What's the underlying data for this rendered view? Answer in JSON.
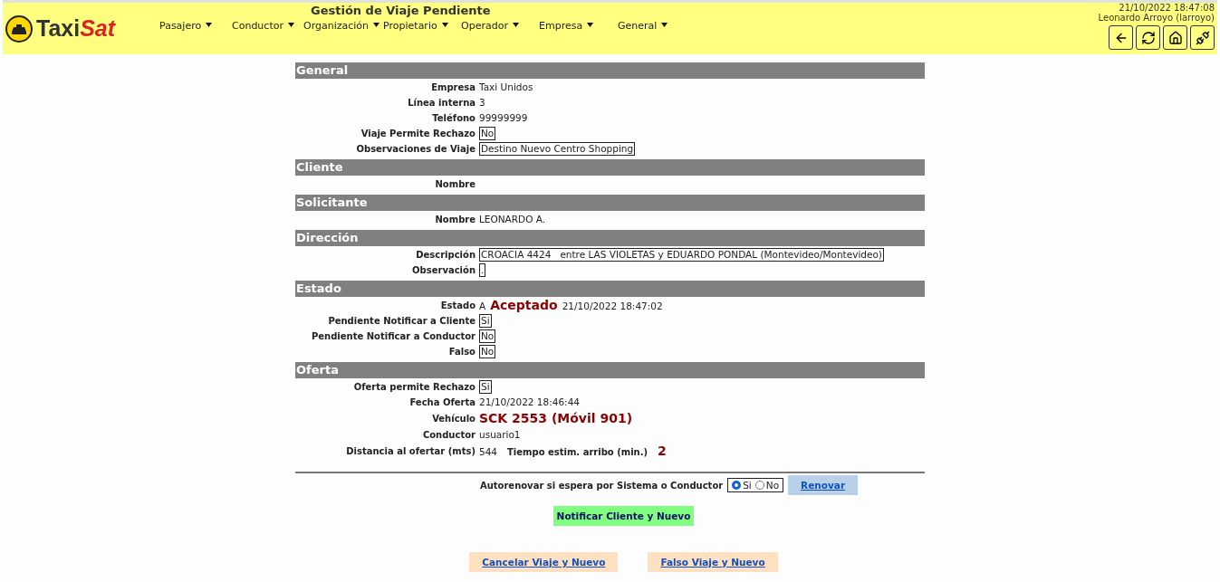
{
  "header": {
    "logo": [
      {
        "kind": "plain",
        "text": "Taxi"
      },
      {
        "kind": "accent",
        "text": "Sat"
      }
    ],
    "title": "Gestión de Viaje Pendiente",
    "datetime": "21/10/2022 18:47:08",
    "user": "Leonardo Arroyo (larroyo)",
    "menu": [
      {
        "label": "Pasajero"
      },
      {
        "label": "Conductor"
      },
      {
        "label": "Organización"
      },
      {
        "label": "Propietario"
      },
      {
        "label": "Operador"
      },
      {
        "label": "Empresa"
      },
      {
        "label": "General"
      }
    ],
    "tools": [
      {
        "kind": "back"
      },
      {
        "kind": "refresh"
      },
      {
        "kind": "home"
      },
      {
        "kind": "plug"
      }
    ]
  },
  "sections": [
    {
      "title": "General",
      "rows": [
        {
          "kind": "text",
          "label": "Empresa",
          "value": "Taxi Unidos"
        },
        {
          "kind": "text",
          "label": "Línea interna",
          "value": "3"
        },
        {
          "kind": "text",
          "label": "Teléfono",
          "value": "99999999"
        },
        {
          "kind": "boxed",
          "label": "Viaje Permite Rechazo",
          "value": "No"
        },
        {
          "kind": "boxed",
          "label": "Observaciones de Viaje",
          "value": "Destino Nuevo Centro Shopping"
        }
      ]
    },
    {
      "title": "Cliente",
      "rows": [
        {
          "kind": "text",
          "label": "Nombre"
        }
      ]
    },
    {
      "title": "Solicitante",
      "rows": [
        {
          "kind": "text",
          "label": "Nombre",
          "value": "LEONARDO A."
        }
      ]
    },
    {
      "title": "Dirección",
      "rows": [
        {
          "kind": "boxed",
          "label": "Descripción",
          "value": "CROACIA 4424   entre LAS VIOLETAS y EDUARDO PONDAL (Montevideo/Montevideo)"
        },
        {
          "kind": "boxed",
          "label": "Observación",
          "value": "."
        }
      ]
    },
    {
      "title": "Estado",
      "rows": [
        {
          "kind": "status",
          "label": "Estado",
          "code": "A",
          "status": "Aceptado",
          "time": "21/10/2022 18:47:02"
        },
        {
          "kind": "boxed",
          "label": "Pendiente Notificar a Cliente",
          "value": "Si"
        },
        {
          "kind": "boxed",
          "label": "Pendiente Notificar a Conductor",
          "value": "No"
        },
        {
          "kind": "boxed",
          "label": "Falso",
          "value": "No"
        }
      ]
    },
    {
      "title": "Oferta",
      "rows": [
        {
          "kind": "boxed",
          "label": "Oferta permite Rechazo",
          "value": "Si"
        },
        {
          "kind": "text",
          "label": "Fecha Oferta",
          "value": "21/10/2022 18:46:44"
        },
        {
          "kind": "highlight",
          "label": "Vehículo",
          "value": "SCK 2553 (Móvil 901)"
        },
        {
          "kind": "text",
          "label": "Conductor",
          "value": "usuario1"
        },
        {
          "kind": "distance",
          "label": "Distancia al ofertar (mts)",
          "value": "544",
          "extra_label": "Tiempo estim. arribo (min.)",
          "extra_value": "2"
        }
      ]
    }
  ],
  "autorenew": {
    "label": "Autorenovar si espera por Sistema o Conductor",
    "options": [
      {
        "label": "Si",
        "selected": true
      },
      {
        "label": "No",
        "selected": false
      }
    ],
    "button": "Renovar"
  },
  "notify_button": "Notificar Cliente y Nuevo",
  "bottom_buttons": [
    "Cancelar Viaje y Nuevo",
    "Falso Viaje y Nuevo"
  ]
}
